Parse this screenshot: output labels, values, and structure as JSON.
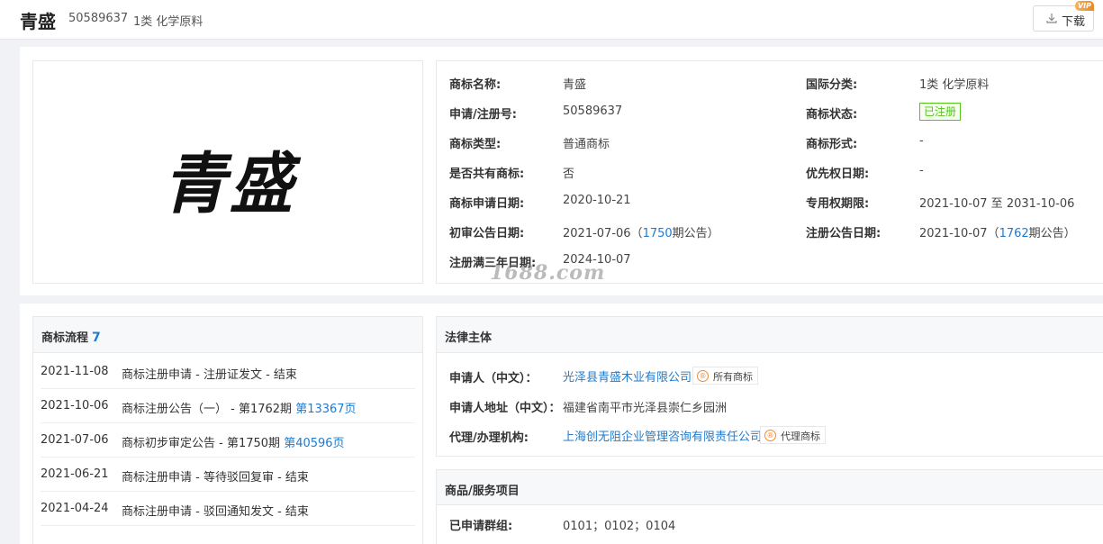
{
  "header": {
    "name": "青盛",
    "reg_no": "50589637",
    "category": "1类 化学原料",
    "download_label": "下载",
    "vip_badge": "VIP"
  },
  "trademark_image_text": "青盛",
  "info": {
    "left": [
      {
        "label": "商标名称:",
        "value": "青盛"
      },
      {
        "label": "申请/注册号:",
        "value": "50589637"
      },
      {
        "label": "商标类型:",
        "value": "普通商标"
      },
      {
        "label": "是否共有商标:",
        "value": "否"
      },
      {
        "label": "商标申请日期:",
        "value": "2020-10-21"
      },
      {
        "label": "初审公告日期:",
        "value_pre": "2021-07-06（",
        "value_link": "1750",
        "value_post": "期公告）"
      },
      {
        "label": "注册满三年日期:",
        "value": "2024-10-07"
      }
    ],
    "right": [
      {
        "label": "国际分类:",
        "value": "1类 化学原料"
      },
      {
        "label": "商标状态:",
        "status": "已注册"
      },
      {
        "label": "商标形式:",
        "value": "-"
      },
      {
        "label": "优先权日期:",
        "value": "-"
      },
      {
        "label": "专用权期限:",
        "value": "2021-10-07 至 2031-10-06"
      },
      {
        "label": "注册公告日期:",
        "value_pre": "2021-10-07（",
        "value_link": "1762",
        "value_post": "期公告）"
      }
    ]
  },
  "watermark": "1688.com",
  "flow": {
    "title": "商标流程",
    "count": "7",
    "rows": [
      {
        "date": "2021-11-08",
        "text": "商标注册申请 - 注册证发文 - 结束",
        "link": ""
      },
      {
        "date": "2021-10-06",
        "text": "商标注册公告（一） - 第1762期 ",
        "link": "第13367页"
      },
      {
        "date": "2021-07-06",
        "text": "商标初步审定公告 - 第1750期 ",
        "link": "第40596页"
      },
      {
        "date": "2021-06-21",
        "text": "商标注册申请 - 等待驳回复审 - 结束",
        "link": ""
      },
      {
        "date": "2021-04-24",
        "text": "商标注册申请 - 驳回通知发文 - 结束",
        "link": ""
      }
    ]
  },
  "legal": {
    "title": "法律主体",
    "rows": [
      {
        "label": "申请人（中文）：",
        "value": "光泽县青盛木业有限公司",
        "tag": "所有商标"
      },
      {
        "label": "申请人地址（中文）：",
        "value": "福建省南平市光泽县崇仁乡园洲"
      },
      {
        "label": "代理/办理机构:",
        "value": "上海创无阻企业管理咨询有限责任公司",
        "tag": "代理商标"
      }
    ]
  },
  "goods": {
    "title": "商品/服务项目",
    "label": "已申请群组:",
    "value": "0101；0102；0104"
  }
}
